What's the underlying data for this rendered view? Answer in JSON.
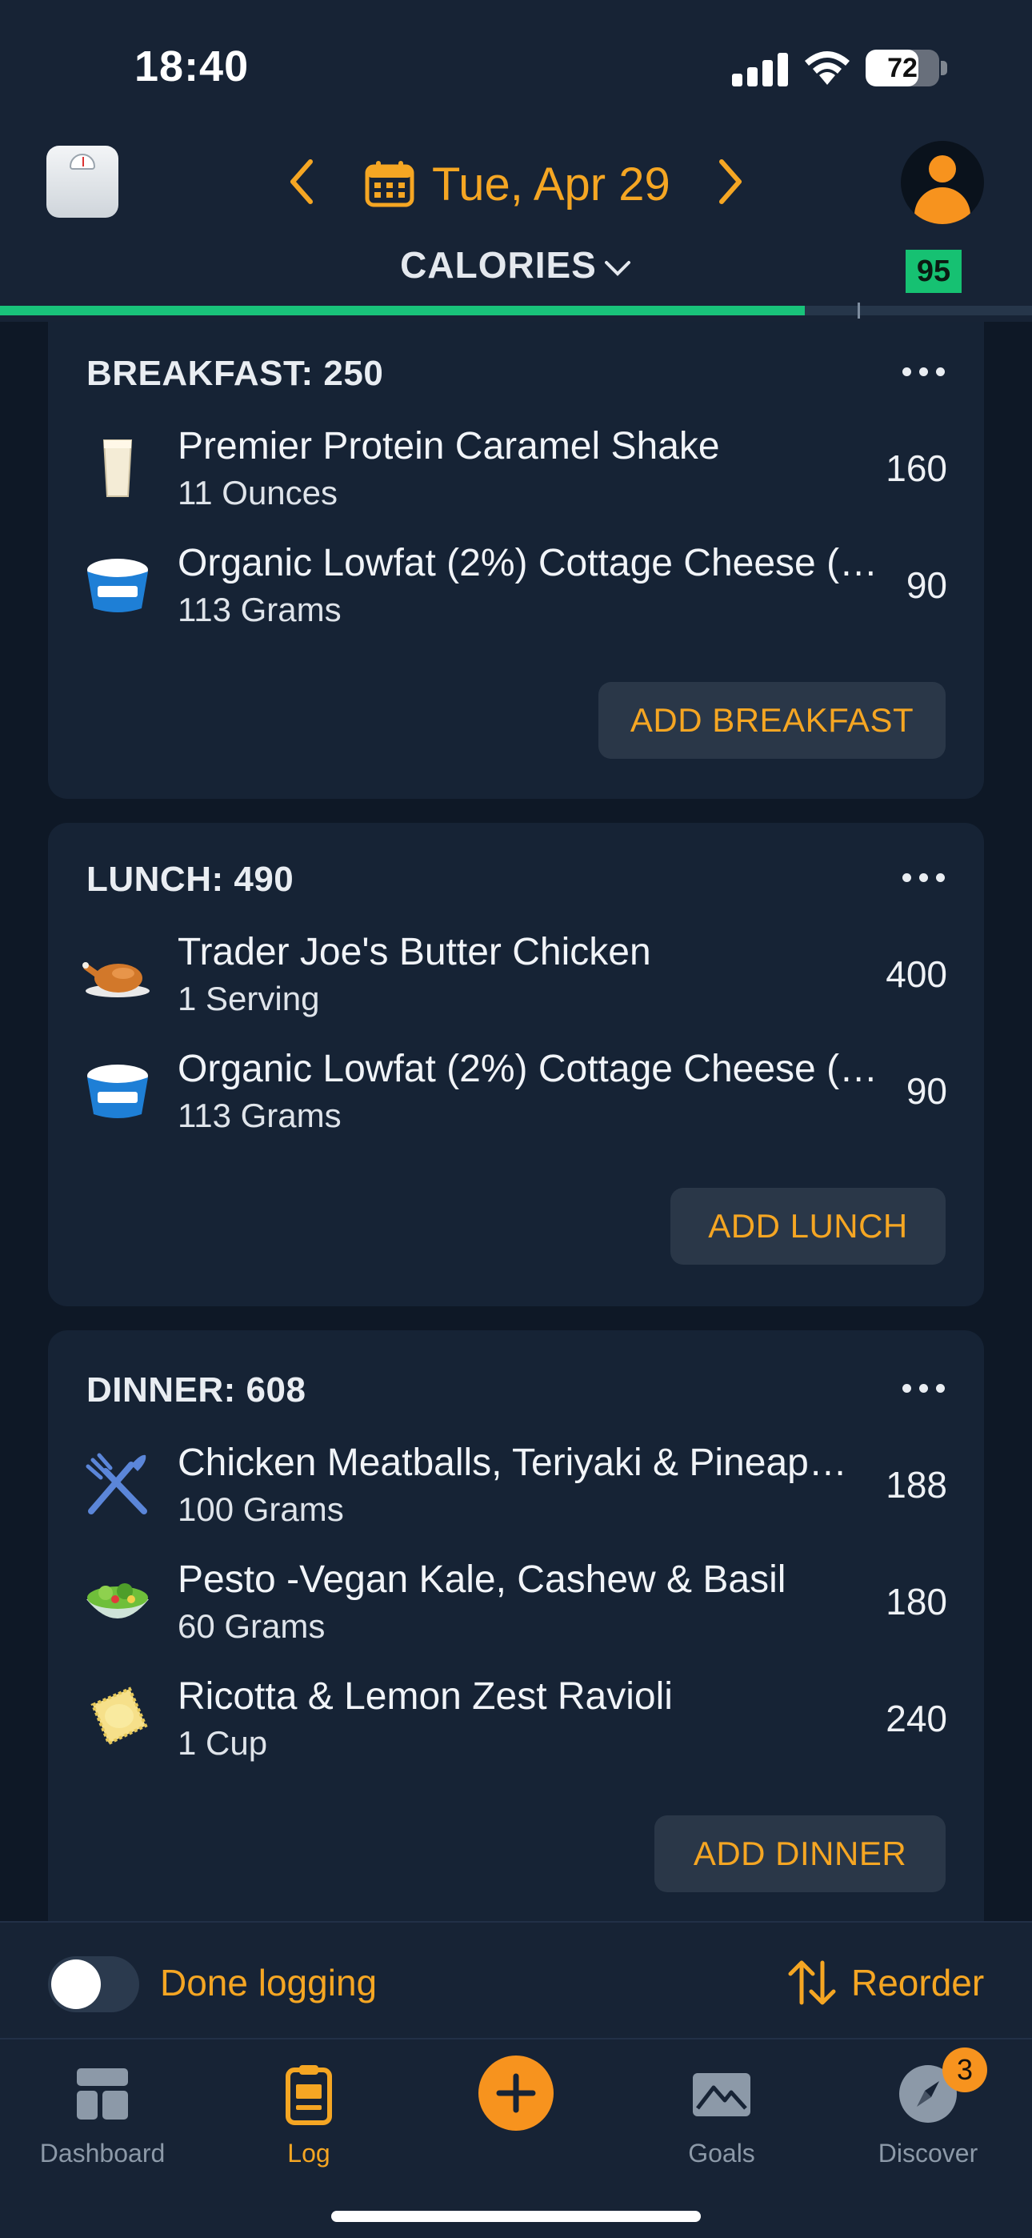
{
  "status_bar": {
    "time": "18:40",
    "battery_percent": "72",
    "battery_level": 0.72
  },
  "header": {
    "date": "Tue, Apr 29",
    "view_selector": "CALORIES",
    "score": "95",
    "daily_progress": 0.78,
    "icons": [
      "scale-icon",
      "chevron-left-icon",
      "calendar-icon",
      "chevron-right-icon",
      "avatar-icon",
      "chevron-down-icon"
    ]
  },
  "meals": {
    "breakfast": {
      "title": "BREAKFAST: 250",
      "add_label": "ADD BREAKFAST",
      "items": [
        {
          "name": "Premier Protein Caramel Shake",
          "qty": "11 Ounces",
          "cal": "160",
          "icon": "shake-icon"
        },
        {
          "name": "Organic Lowfat (2%) Cottage Cheese (…",
          "qty": "113 Grams",
          "cal": "90",
          "icon": "cottage-cheese-icon"
        }
      ]
    },
    "lunch": {
      "title": "LUNCH: 490",
      "add_label": "ADD LUNCH",
      "items": [
        {
          "name": "Trader Joe's Butter Chicken",
          "qty": "1 Serving",
          "cal": "400",
          "icon": "roast-chicken-icon"
        },
        {
          "name": "Organic Lowfat (2%) Cottage Cheese (…",
          "qty": "113 Grams",
          "cal": "90",
          "icon": "cottage-cheese-icon"
        }
      ]
    },
    "dinner": {
      "title": "DINNER: 608",
      "add_label": "ADD DINNER",
      "items": [
        {
          "name": "Chicken Meatballs, Teriyaki & Pineap…",
          "qty": "100 Grams",
          "cal": "188",
          "icon": "fork-knife-icon"
        },
        {
          "name": "Pesto -Vegan Kale, Cashew & Basil",
          "qty": "60 Grams",
          "cal": "180",
          "icon": "salad-icon"
        },
        {
          "name": "Ricotta & Lemon Zest Ravioli",
          "qty": "1 Cup",
          "cal": "240",
          "icon": "ravioli-icon"
        }
      ]
    }
  },
  "action_bar": {
    "done_logging": "Done logging",
    "done_logging_on": false,
    "reorder": "Reorder"
  },
  "tabs": {
    "dashboard": "Dashboard",
    "log": "Log",
    "goals": "Goals",
    "discover": "Discover",
    "discover_badge": "3",
    "active": "log"
  },
  "colors": {
    "background": "#0e1826",
    "card": "#162335",
    "accent": "#f5a623",
    "progress": "#19c27a",
    "score": "#16c172"
  }
}
